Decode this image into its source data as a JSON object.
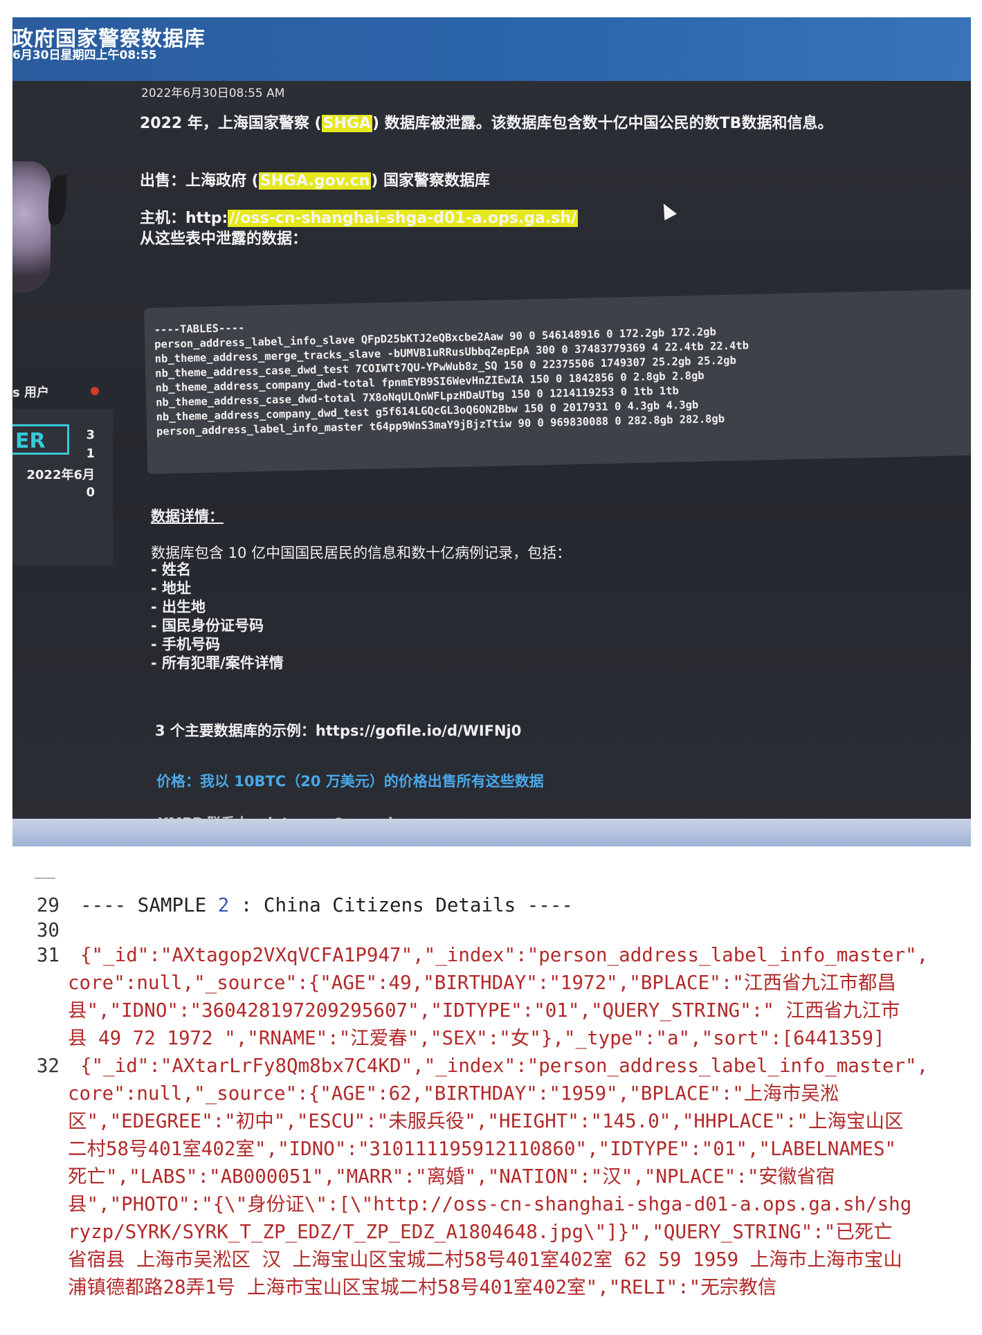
{
  "forum": {
    "site_title": "政府国家警察数据库",
    "site_date": "6月30日星期四上午08:55",
    "user_group": "s 用户",
    "badge": "ER",
    "stats": [
      "3",
      "1",
      "2022年6月",
      "0"
    ],
    "post": {
      "date": "2022年6月30日08:55 AM",
      "intro_before": "2022 年，上海国家警察 (",
      "intro_hl": "SHGA",
      "intro_after": ") 数据库被泄露。该数据库包含数十亿中国公民的数TB数据和信息。",
      "sale_before": "出售：上海政府 (",
      "sale_hl": "SHGA.gov.cn",
      "sale_after": ") 国家警察数据库",
      "host_label": "主机：http:",
      "host_hl": "//oss-cn-shanghai-shga-d01-a.ops.ga.sh/",
      "tables_leak": "从这些表中泄露的数据：",
      "tables_header": "----TABLES----",
      "tables": [
        "person_address_label_info_slave QFpD25bKTJ2eQBxcbe2Aaw 90 0 546148916 0 172.2gb 172.2gb",
        "nb_theme_address_merge_tracks_slave -bUMVB1uRRusUbbqZepEpA 300 0 37483779369 4 22.4tb 22.4tb",
        "nb_theme_address_case_dwd_test 7COIWTt7QU-YPwWub8z_SQ 150 0 22375506 1749307 25.2gb 25.2gb",
        "nb_theme_address_company_dwd-total fpnmEYB9SI6WevHnZIEwIA 150 0 1842856 0 2.8gb 2.8gb",
        "nb_theme_address_case_dwd-total 7X8oNqULQnWFLpzHDaUTbg 150 0 1214119253 0 1tb 1tb",
        "nb_theme_address_company_dwd_test g5f614LGQcGL3oQ6ON2Bbw 150 0 2017931 0 4.3gb 4.3gb",
        "person_address_label_info_master t64pp9WnS3maY9jBjzTtiw 90 0 969830088 0 282.8gb 282.8gb"
      ],
      "details_title": "数据详情：",
      "details_intro": "数据库包含 10 亿中国国民居民的信息和数十亿病例记录，包括：",
      "details_items": [
        "- 姓名",
        "- 地址",
        "- 出生地",
        "- 国民身份证号码",
        "- 手机号码",
        "- 所有犯罪/案件详情"
      ],
      "samples": "3 个主要数据库的示例：https://gofile.io/d/WIFNj0",
      "price": "价格：我以 10BTC（20 万美元）的价格出售所有这些数据",
      "xmpp": "XMPP 联系人：datamen@rows.im"
    }
  },
  "editor": {
    "lines": [
      {
        "num": "29",
        "text": "---- SAMPLE ",
        "num_token": "2",
        "text_after": " : China Citizens Details ----"
      },
      {
        "num": "30",
        "text": ""
      },
      {
        "num": "31",
        "text": "{\"_id\":\"AXtagop2VXqVCFA1P947\",\"_index\":\"person_address_label_info_master\","
      },
      {
        "num": "32",
        "text": "{\"_id\":\"AXtarLrFy8Qm8bx7C4KD\",\"_index\":\"person_address_label_info_master\","
      }
    ],
    "line31_cont": [
      "core\":null,\"_source\":{\"AGE\":49,\"BIRTHDAY\":\"1972\",\"BPLACE\":\"江西省九江市都昌",
      "县\",\"IDNO\":\"360428197209295607\",\"IDTYPE\":\"01\",\"QUERY_STRING\":\"  江西省九江市",
      "县   49 72 1972 \",\"RNAME\":\"江爱春\",\"SEX\":\"女\"},\"_type\":\"a\",\"sort\":[6441359]"
    ],
    "line32_cont": [
      "core\":null,\"_source\":{\"AGE\":62,\"BIRTHDAY\":\"1959\",\"BPLACE\":\"上海市吴淞",
      "区\",\"EDEGREE\":\"初中\",\"ESCU\":\"未服兵役\",\"HEIGHT\":\"145.0\",\"HHPLACE\":\"上海宝山区",
      "二村58号401室402室\",\"IDNO\":\"310111195912110860\",\"IDTYPE\":\"01\",\"LABELNAMES\"",
      "死亡\",\"LABS\":\"AB000051\",\"MARR\":\"离婚\",\"NATION\":\"汉\",\"NPLACE\":\"安徽省宿",
      "县\",\"PHOTO\":\"{\\\"身份证\\\":[\\\"http://oss-cn-shanghai-shga-d01-a.ops.ga.sh/shg",
      "ryzp/SYRK/SYRK_T_ZP_EDZ/T_ZP_EDZ_A1804648.jpg\\\"]}\",\"QUERY_STRING\":\"已死亡",
      "省宿县 上海市吴淞区 汉 上海宝山区宝城二村58号401室402室 62 59 1959 上海市上海市宝山",
      "浦镇德都路28弄1号 上海市宝山区宝城二村58号401室402室\",\"RELI\":\"无宗教信"
    ]
  }
}
